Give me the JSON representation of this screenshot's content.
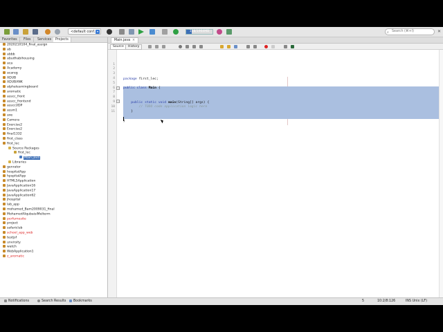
{
  "toolbar": {
    "config": "<default conf...",
    "memory": {
      "text": "118/1964MB",
      "fraction": 0.06
    },
    "search_placeholder": "Search (⌘+I)"
  },
  "left_panel": {
    "tabs": [
      "Favorites",
      "Files",
      "Services",
      "Projects"
    ],
    "active_tab": "Projects",
    "items": [
      {
        "label": "2020210104_final_assign",
        "indent": 0,
        "icon": "project-icon"
      },
      {
        "label": "ab",
        "indent": 0,
        "icon": "project-icon"
      },
      {
        "label": "abbb",
        "indent": 0,
        "icon": "project-icon"
      },
      {
        "label": "abudhabihousing",
        "indent": 0,
        "icon": "project-icon"
      },
      {
        "label": "aca",
        "indent": 0,
        "icon": "project-icon"
      },
      {
        "label": "Academy",
        "indent": 0,
        "icon": "project-icon"
      },
      {
        "label": "acareg",
        "indent": 0,
        "icon": "project-icon"
      },
      {
        "label": "ADUB",
        "indent": 0,
        "icon": "project-icon"
      },
      {
        "label": "ADUBANK",
        "indent": 0,
        "icon": "project-icon"
      },
      {
        "label": "alphalearningboard",
        "indent": 0,
        "icon": "project-icon"
      },
      {
        "label": "aromatic",
        "indent": 0,
        "icon": "project-icon"
      },
      {
        "label": "asscc_front",
        "indent": 0,
        "icon": "project-icon"
      },
      {
        "label": "asscc_frontend",
        "indent": 0,
        "icon": "project-icon"
      },
      {
        "label": "assccUDP",
        "indent": 0,
        "icon": "project-icon"
      },
      {
        "label": "assm1",
        "indent": 0,
        "icon": "project-icon"
      },
      {
        "label": "axe",
        "indent": 0,
        "icon": "project-icon"
      },
      {
        "label": "Camera",
        "indent": 0,
        "icon": "project-icon"
      },
      {
        "label": "Exercise2",
        "indent": 0,
        "icon": "project-icon"
      },
      {
        "label": "Exercise2",
        "indent": 0,
        "icon": "project-icon"
      },
      {
        "label": "final1332",
        "indent": 0,
        "icon": "project-icon"
      },
      {
        "label": "first_class",
        "indent": 0,
        "icon": "project-icon"
      },
      {
        "label": "first_lec",
        "indent": 0,
        "icon": "project-icon"
      },
      {
        "label": "Source Packages",
        "indent": 1,
        "icon": "folder-icon"
      },
      {
        "label": "first_lec",
        "indent": 2,
        "icon": "package-icon"
      },
      {
        "label": "Main.java",
        "indent": 3,
        "icon": "java-file-icon",
        "selected": true
      },
      {
        "label": "Libraries",
        "indent": 1,
        "icon": "folder-icon"
      },
      {
        "label": "genrator",
        "indent": 0,
        "icon": "project-icon"
      },
      {
        "label": "hospitalApp",
        "indent": 0,
        "icon": "project-icon"
      },
      {
        "label": "hpspitalApp",
        "indent": 0,
        "icon": "project-icon"
      },
      {
        "label": "HTML5Application",
        "indent": 0,
        "icon": "project-icon"
      },
      {
        "label": "JavaApplication16",
        "indent": 0,
        "icon": "project-icon"
      },
      {
        "label": "JavaApplication17",
        "indent": 0,
        "icon": "project-icon"
      },
      {
        "label": "JavaApplication62",
        "indent": 0,
        "icon": "project-icon"
      },
      {
        "label": "jhospital",
        "indent": 0,
        "icon": "project-icon"
      },
      {
        "label": "lab_app",
        "indent": 0,
        "icon": "project-icon"
      },
      {
        "label": "mohamed_Bam2009031_final",
        "indent": 0,
        "icon": "project-icon"
      },
      {
        "label": "MohamedAlqubaisiMelterm",
        "indent": 0,
        "icon": "project-icon"
      },
      {
        "label": "perfumesite",
        "indent": 0,
        "icon": "project-icon",
        "error": true
      },
      {
        "label": "project",
        "indent": 0,
        "icon": "project-icon"
      },
      {
        "label": "safariclub",
        "indent": 0,
        "icon": "project-icon"
      },
      {
        "label": "school_app_web",
        "indent": 0,
        "icon": "project-icon",
        "error": true
      },
      {
        "label": "testjsf",
        "indent": 0,
        "icon": "project-icon"
      },
      {
        "label": "unvirsity",
        "indent": 0,
        "icon": "project-icon"
      },
      {
        "label": "watch",
        "indent": 0,
        "icon": "project-icon"
      },
      {
        "label": "WebApplication1",
        "indent": 0,
        "icon": "project-icon"
      },
      {
        "label": "z_aromatic",
        "indent": 0,
        "icon": "project-icon",
        "error": true
      }
    ]
  },
  "editor": {
    "file_tab": "Main.java",
    "tabs": [
      "Source",
      "History"
    ],
    "active_tab": "Source",
    "lines": [
      {
        "n": "1",
        "text": "package first_lec;"
      },
      {
        "n": "2",
        "text": ""
      },
      {
        "n": "3",
        "text": "public class Main {"
      },
      {
        "n": "4",
        "text": ""
      },
      {
        "n": "5",
        "text": ""
      },
      {
        "n": "6",
        "text": "    public static void main(String[] args) {"
      },
      {
        "n": "7",
        "text": "        // TODO code application logic here"
      },
      {
        "n": "8",
        "text": "    }"
      },
      {
        "n": "9",
        "text": ""
      },
      {
        "n": "10",
        "text": "}"
      },
      {
        "n": "11",
        "text": ""
      }
    ]
  },
  "status_bar": {
    "notifications": "Notifications",
    "search_results": "Search Results",
    "bookmarks": "Bookmarks",
    "counter": "5",
    "position": "10:2/8:126",
    "mode": "INS Unix (LF)"
  },
  "colors": {
    "selection": "#aabfe0",
    "keyword": "#2a3ea8",
    "comment": "#8a9a9a",
    "tree_selected": "#3d6fb6",
    "error_project": "#dd2222"
  }
}
